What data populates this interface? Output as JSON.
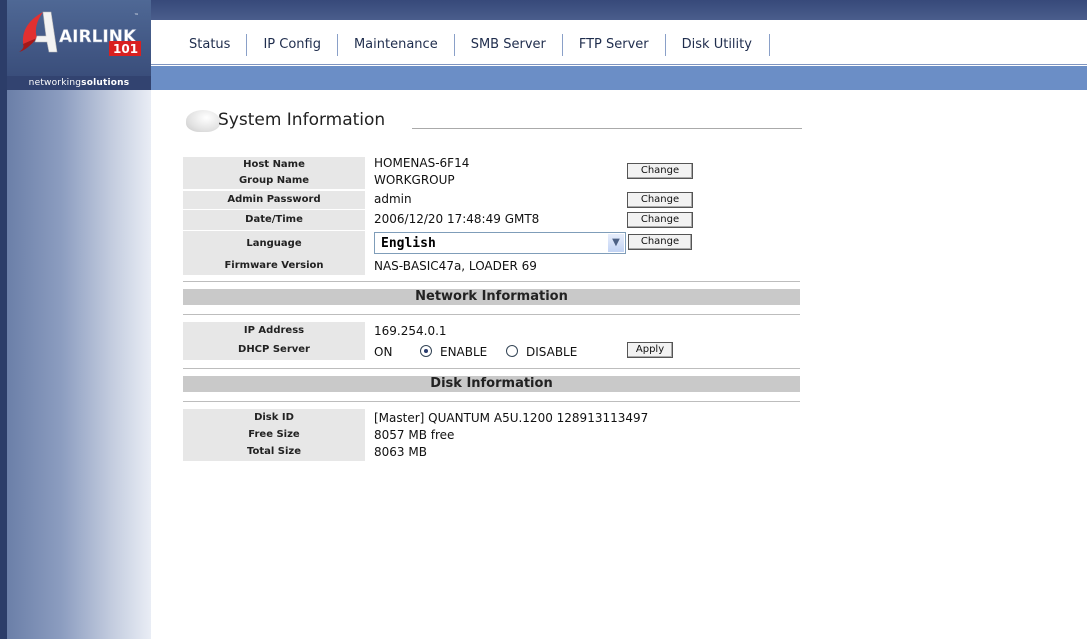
{
  "brand": {
    "logo_text": "AIRLINK",
    "logo_number": "101",
    "slogan_prefix": "networking",
    "slogan_suffix": "solutions"
  },
  "nav": [
    "Status",
    "IP Config",
    "Maintenance",
    "SMB Server",
    "FTP Server",
    "Disk Utility"
  ],
  "title": "System Information",
  "system": {
    "host_name_label": "Host Name",
    "host_name": "HOMENAS-6F14",
    "group_name_label": "Group Name",
    "group_name": "WORKGROUP",
    "admin_password_label": "Admin Password",
    "admin_password": "admin",
    "datetime_label": "Date/Time",
    "datetime": "2006/12/20 17:48:49 GMT8",
    "language_label": "Language",
    "language": "English",
    "firmware_label": "Firmware Version",
    "firmware": "NAS-BASIC47a, LOADER 69",
    "change_label": "Change"
  },
  "network": {
    "header": "Network Information",
    "ip_label": "IP Address",
    "ip": "169.254.0.1",
    "dhcp_label": "DHCP Server",
    "dhcp_status": "ON",
    "enable_label": "ENABLE",
    "disable_label": "DISABLE",
    "dhcp_selected": "ENABLE",
    "apply_label": "Apply"
  },
  "disk": {
    "header": "Disk Information",
    "id_label": "Disk ID",
    "id": "[Master] QUANTUM A5U.1200 128913113497",
    "free_label": "Free Size",
    "free": "8057 MB free",
    "total_label": "Total Size",
    "total": "8063 MB"
  },
  "colors": {
    "topbar": "#3f5283",
    "menu_bar": "#6b8ec6",
    "label_bg": "#e7e7e7",
    "section_bg": "#c9c9c9",
    "logo_red": "#d92020"
  }
}
